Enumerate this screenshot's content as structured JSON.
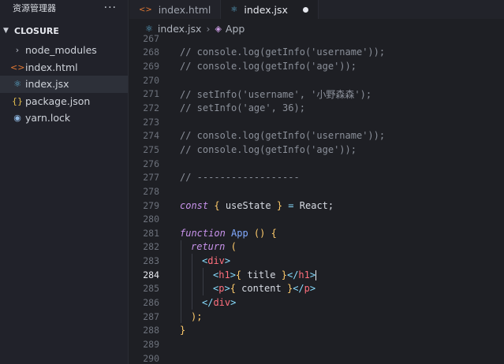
{
  "sidebar": {
    "title": "资源管理器",
    "more": "···",
    "section": "CLOSURE",
    "items": [
      {
        "label": "node_modules",
        "icon": "chevron-right-icon",
        "glyph": "›"
      },
      {
        "label": "index.html",
        "icon": "html-icon",
        "glyph": "<>"
      },
      {
        "label": "index.jsx",
        "icon": "react-icon",
        "glyph": "⚛"
      },
      {
        "label": "package.json",
        "icon": "json-icon",
        "glyph": "{}"
      },
      {
        "label": "yarn.lock",
        "icon": "yarn-icon",
        "glyph": "🧶"
      }
    ]
  },
  "tabs": [
    {
      "label": "index.html"
    },
    {
      "label": "index.jsx"
    }
  ],
  "breadcrumb": {
    "file": "index.jsx",
    "symbol": "App"
  },
  "lines": [
    {
      "n": "267",
      "cm": "",
      "html": ""
    },
    {
      "n": "268",
      "cm": "// console.log(getInfo('username'));"
    },
    {
      "n": "269",
      "cm": "// console.log(getInfo('age'));"
    },
    {
      "n": "270",
      "cm": ""
    },
    {
      "n": "271",
      "cm": "// setInfo('username', '小野森森');"
    },
    {
      "n": "272",
      "cm": "// setInfo('age', 36);"
    },
    {
      "n": "273",
      "cm": ""
    },
    {
      "n": "274",
      "cm": "// console.log(getInfo('username'));"
    },
    {
      "n": "275",
      "cm": "// console.log(getInfo('age'));"
    },
    {
      "n": "276",
      "cm": ""
    },
    {
      "n": "277",
      "cm": "// ------------------"
    },
    {
      "n": "278",
      "cm": ""
    },
    {
      "n": "279",
      "cm": ""
    },
    {
      "n": "280",
      "cm": ""
    },
    {
      "n": "281",
      "cm": ""
    },
    {
      "n": "282",
      "cm": ""
    },
    {
      "n": "283",
      "cm": ""
    },
    {
      "n": "284",
      "cm": ""
    },
    {
      "n": "285",
      "cm": ""
    },
    {
      "n": "286",
      "cm": ""
    },
    {
      "n": "287",
      "cm": ""
    },
    {
      "n": "288",
      "cm": ""
    },
    {
      "n": "289",
      "cm": ""
    },
    {
      "n": "290",
      "cm": ""
    }
  ],
  "code": {
    "l279": {
      "kw": "const",
      "b1": "{",
      "v": " useState ",
      "b2": "}",
      "eq": " = ",
      "react": "React",
      "semi": ";"
    },
    "l281": {
      "kw": "function",
      "name": " App ",
      "paren": "()",
      "b": " {"
    },
    "l282": {
      "kw": "return",
      "paren": " ("
    },
    "l283": {
      "open": "<",
      "tag": "div",
      "close": ">"
    },
    "l284": {
      "a": "<",
      "tag": "h1",
      "b": ">",
      "br1": "{",
      "v": " title ",
      "br2": "}",
      "c": "</",
      "tag2": "h1",
      "d": ">"
    },
    "l285": {
      "a": "<",
      "tag": "p",
      "b": ">",
      "br1": "{",
      "v": " content ",
      "br2": "}",
      "c": "</",
      "tag2": "p",
      "d": ">"
    },
    "l286": {
      "open": "</",
      "tag": "div",
      "close": ">"
    },
    "l287": {
      "text": ");"
    },
    "l288": {
      "text": "}"
    }
  },
  "current_line": "284",
  "colors": {
    "accent": "#82aaff",
    "background": "#1e1f24"
  }
}
